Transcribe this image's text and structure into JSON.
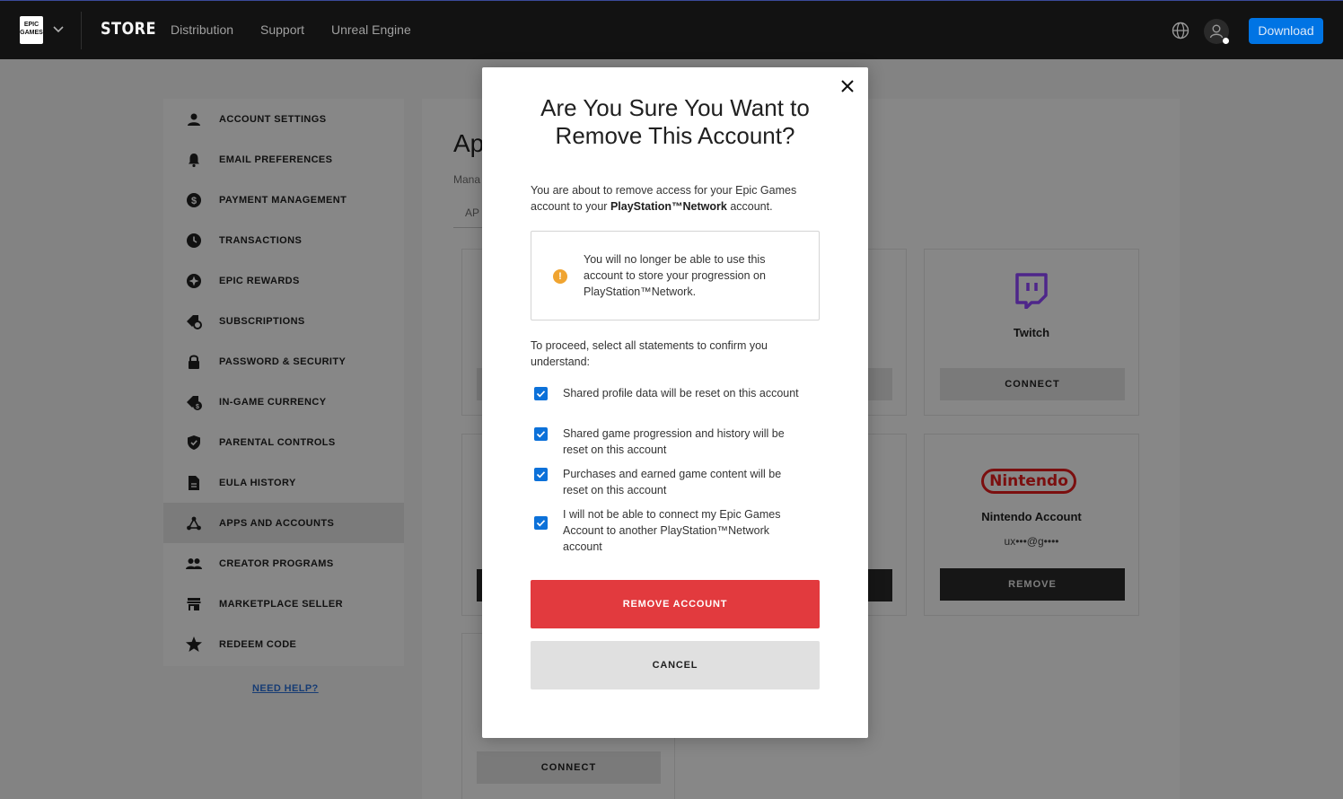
{
  "topnav": {
    "logo_text": "EPIC GAMES",
    "store_label": "STORE",
    "links": [
      "Distribution",
      "Support",
      "Unreal Engine"
    ],
    "download_label": "Download"
  },
  "sidebar": {
    "items": [
      {
        "label": "ACCOUNT SETTINGS",
        "icon": "person-icon"
      },
      {
        "label": "EMAIL PREFERENCES",
        "icon": "bell-icon"
      },
      {
        "label": "PAYMENT MANAGEMENT",
        "icon": "dollar-icon"
      },
      {
        "label": "TRANSACTIONS",
        "icon": "clock-icon"
      },
      {
        "label": "EPIC REWARDS",
        "icon": "rewards-icon"
      },
      {
        "label": "SUBSCRIPTIONS",
        "icon": "subscriptions-icon"
      },
      {
        "label": "PASSWORD & SECURITY",
        "icon": "lock-icon"
      },
      {
        "label": "IN-GAME CURRENCY",
        "icon": "currency-icon"
      },
      {
        "label": "PARENTAL CONTROLS",
        "icon": "shield-icon"
      },
      {
        "label": "EULA HISTORY",
        "icon": "document-icon"
      },
      {
        "label": "APPS AND ACCOUNTS",
        "icon": "apps-icon",
        "active": true
      },
      {
        "label": "CREATOR PROGRAMS",
        "icon": "people-icon"
      },
      {
        "label": "MARKETPLACE SELLER",
        "icon": "store-icon"
      },
      {
        "label": "REDEEM CODE",
        "icon": "star-icon"
      }
    ],
    "need_help": "NEED HELP?"
  },
  "main": {
    "title_partial": "Ap",
    "subtitle_partial": "Mana",
    "tab_partial": "AP"
  },
  "cards": {
    "twitch": {
      "name": "Twitch",
      "button": "CONNECT",
      "color": "#9146ff"
    },
    "nintendo": {
      "name": "Nintendo Account",
      "masked_email": "ux•••@g••••",
      "button": "REMOVE",
      "logo_text": "Nintendo"
    },
    "bottom_left": {
      "button": "CONNECT"
    }
  },
  "modal": {
    "title": "Are You Sure You Want to Remove This Account?",
    "desc_prefix": "You are about to remove access for your Epic Games account to your ",
    "desc_bold": "PlayStation™Network",
    "desc_suffix": " account.",
    "warning_text": "You will no longer be able to use this account to store your progression on PlayStation™Network.",
    "proceed_text": "To proceed, select all statements to confirm you understand:",
    "statements": [
      "Shared profile data will be reset on this account",
      "Shared game progression and history will be reset on this account",
      "Purchases and earned game content will be reset on this account",
      "I will not be able to connect my Epic Games Account to another PlayStation™Network account"
    ],
    "remove_label": "REMOVE ACCOUNT",
    "cancel_label": "CANCEL"
  },
  "colors": {
    "nav_bg": "#121212",
    "download_blue": "#0074e4",
    "remove_red": "#e23a3e",
    "checkbox_blue": "#0c71d9",
    "warning_orange": "#f0a430"
  }
}
